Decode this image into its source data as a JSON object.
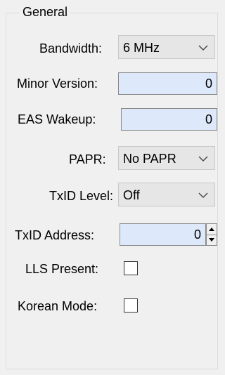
{
  "group": {
    "title": "General"
  },
  "fields": {
    "bandwidth": {
      "label": "Bandwidth:",
      "value": "6 MHz"
    },
    "minor_version": {
      "label": "Minor Version:",
      "value": "0"
    },
    "eas_wakeup": {
      "label": "EAS Wakeup:",
      "value": "0"
    },
    "papr": {
      "label": "PAPR:",
      "value": "No PAPR"
    },
    "txid_level": {
      "label": "TxID Level:",
      "value": "Off"
    },
    "txid_address": {
      "label": "TxID Address:",
      "value": "0"
    },
    "lls_present": {
      "label": "LLS Present:",
      "checked": false
    },
    "korean_mode": {
      "label": "Korean Mode:",
      "checked": false
    }
  },
  "icons": {
    "dropdown": "chevron-down-icon",
    "spinner_up": "spin-up-icon",
    "spinner_down": "spin-down-icon"
  }
}
